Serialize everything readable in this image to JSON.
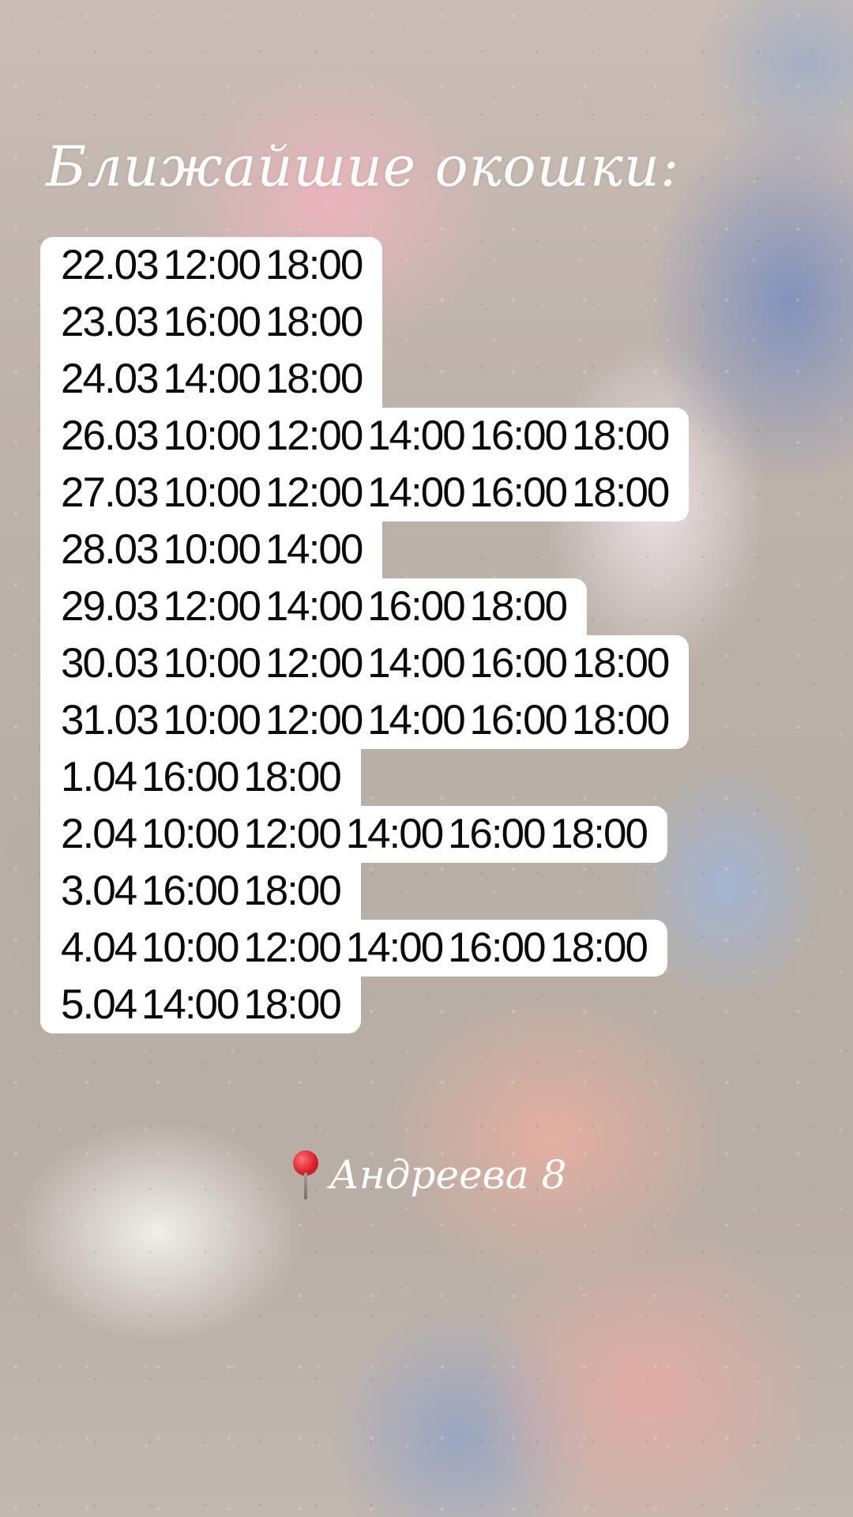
{
  "title": "Ближайшие окошки:",
  "slots": [
    "22.03 12:00 18:00",
    "23.03 16:00 18:00",
    "24.03 14:00 18:00",
    "26.03 10:00 12:00 14:00 16:00 18:00",
    "27.03 10:00 12:00 14:00 16:00 18:00",
    "28.03 10:00 14:00",
    "29.03 12:00 14:00 16:00 18:00",
    "30.03 10:00 12:00 14:00 16:00 18:00",
    "31.03 10:00 12:00 14:00 16:00 18:00",
    "1.04 16:00 18:00",
    "2.04 10:00 12:00 14:00 16:00 18:00",
    "3.04 16:00 18:00",
    "4.04 10:00 12:00 14:00 16:00 18:00",
    "5.04 14:00 18:00"
  ],
  "address": {
    "icon": "pushpin-icon",
    "text": "Андреева 8"
  }
}
